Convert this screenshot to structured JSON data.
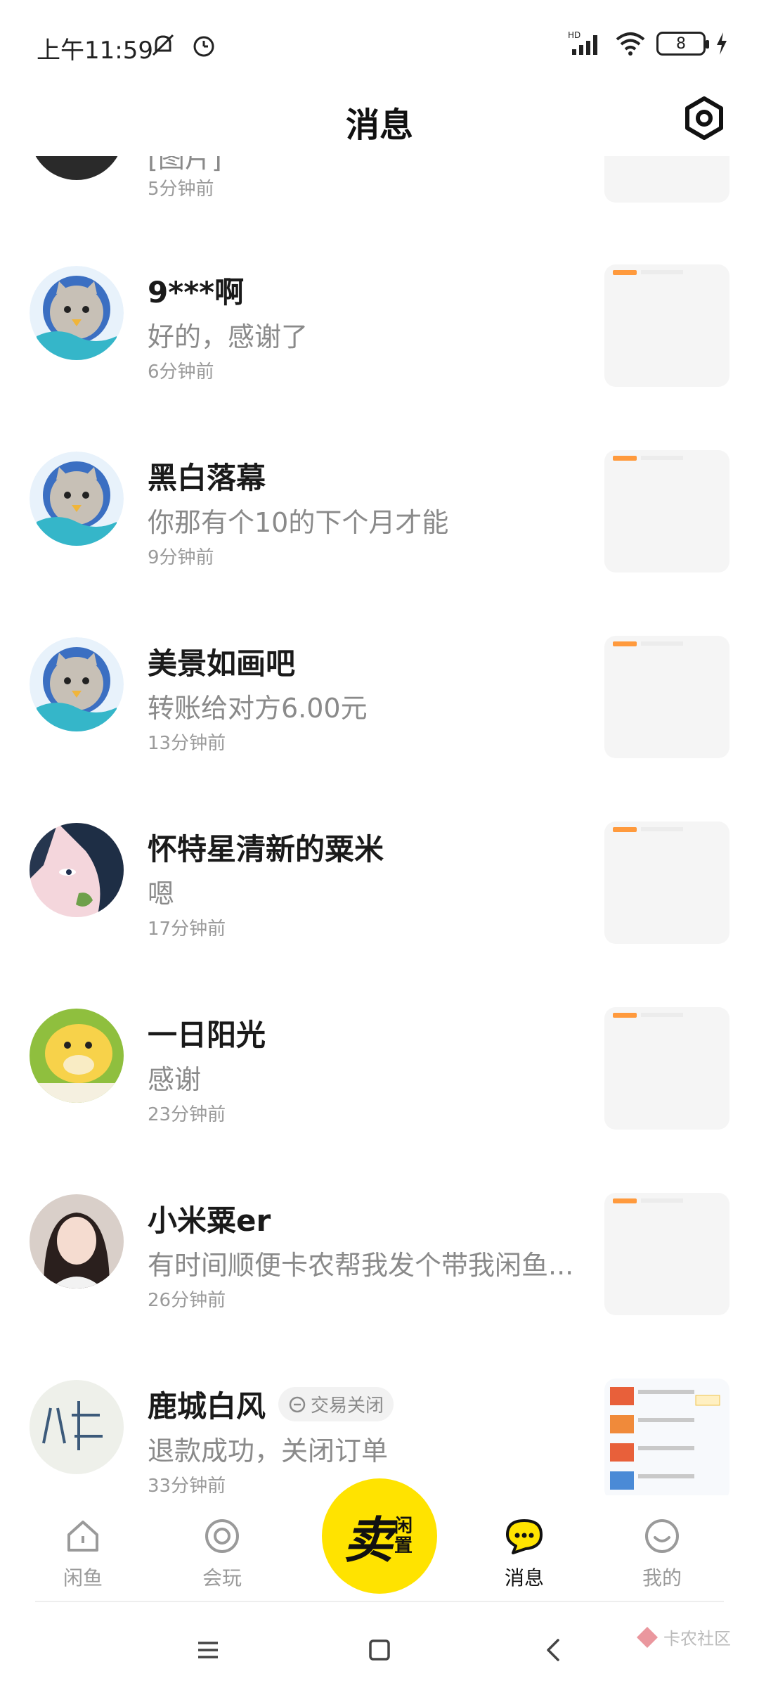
{
  "status_bar": {
    "time": "上午11:59",
    "battery": "8",
    "network": "HD"
  },
  "header": {
    "title": "消息",
    "settings_icon": "settings-icon"
  },
  "conversations": [
    {
      "name": "",
      "preview": "[图片]",
      "time": "5分钟前"
    },
    {
      "name": "9***啊",
      "preview": "好的，感谢了",
      "time": "6分钟前"
    },
    {
      "name": "黑白落幕",
      "preview": "你那有个10的下个月才能",
      "time": "9分钟前"
    },
    {
      "name": "美景如画吧",
      "preview": "转账给对方6.00元",
      "time": "13分钟前"
    },
    {
      "name": "怀特星清新的粟米",
      "preview": "嗯",
      "time": "17分钟前"
    },
    {
      "name": "一日阳光",
      "preview": "感谢",
      "time": "23分钟前"
    },
    {
      "name": "小米粟er",
      "preview": "有时间顺便卡农帮我发个带我闲鱼...",
      "time": "26分钟前"
    },
    {
      "name": "鹿城白风",
      "badge": "交易关闭",
      "preview": "退款成功，关闭订单",
      "time": "33分钟前"
    }
  ],
  "nav": {
    "items": [
      {
        "label": "闲鱼",
        "icon": "home-icon"
      },
      {
        "label": "会玩",
        "icon": "circle-icon"
      },
      {
        "label": "消息",
        "icon": "message-icon",
        "active": true
      },
      {
        "label": "我的",
        "icon": "profile-icon"
      }
    ],
    "sell": {
      "main": "卖",
      "sub": "闲置"
    }
  },
  "watermark": "卡农社区",
  "colors": {
    "accent": "#ffe300",
    "text_primary": "#1a1a1a",
    "text_secondary": "#8a8a8a"
  }
}
